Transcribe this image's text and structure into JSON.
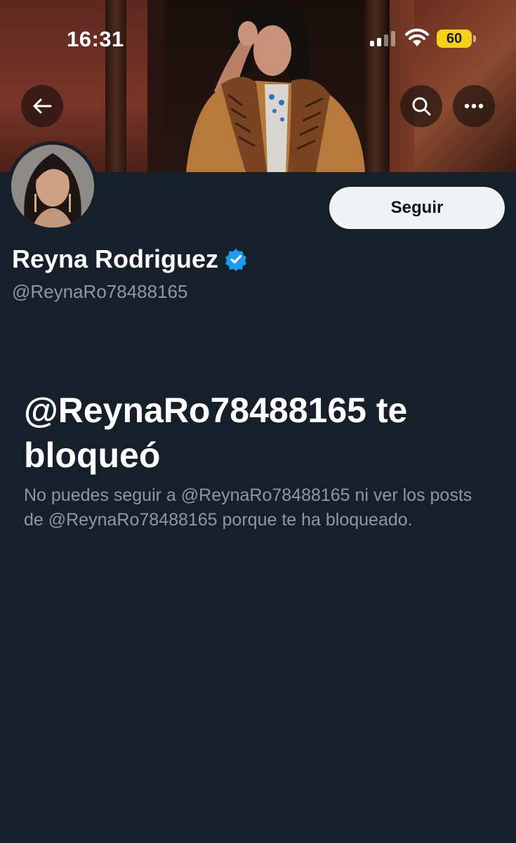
{
  "status_bar": {
    "time": "16:31",
    "battery_level": "60",
    "icons": [
      "signal-icon",
      "wifi-icon",
      "battery-icon"
    ]
  },
  "header": {
    "back_icon": "arrow-left-icon",
    "search_icon": "search-icon",
    "more_icon": "more-horizontal-icon"
  },
  "profile": {
    "display_name": "Reyna Rodriguez",
    "verified": true,
    "handle": "@ReynaRo78488165",
    "follow_label": "Seguir"
  },
  "blocked": {
    "title": "@ReynaRo78488165 te bloqueó",
    "description": "No puedes seguir a @ReynaRo78488165 ni ver los posts de @ReynaRo78488165 porque te ha bloqueado."
  },
  "colors": {
    "background": "#15202b",
    "follow_button_bg": "#eff3f4",
    "secondary_text": "#8b98a5",
    "verified_badge": "#1d9bf0",
    "battery": "#f5d11a"
  }
}
